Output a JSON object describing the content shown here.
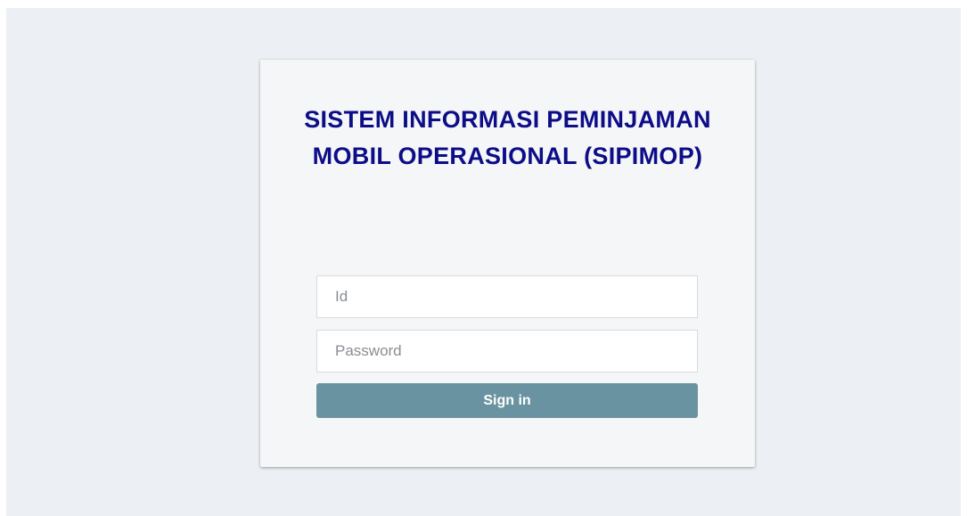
{
  "login": {
    "title": "SISTEM INFORMASI PEMINJAMAN MOBIL OPERASIONAL (SIPIMOP)",
    "id_field": {
      "placeholder": "Id",
      "value": ""
    },
    "password_field": {
      "placeholder": "Password",
      "value": ""
    },
    "signin_label": "Sign in"
  },
  "colors": {
    "page_background": "#eceff3",
    "card_background": "#f5f6f7",
    "title_color": "#0d0d88",
    "button_background": "#6a93a1",
    "button_text": "#ffffff"
  }
}
